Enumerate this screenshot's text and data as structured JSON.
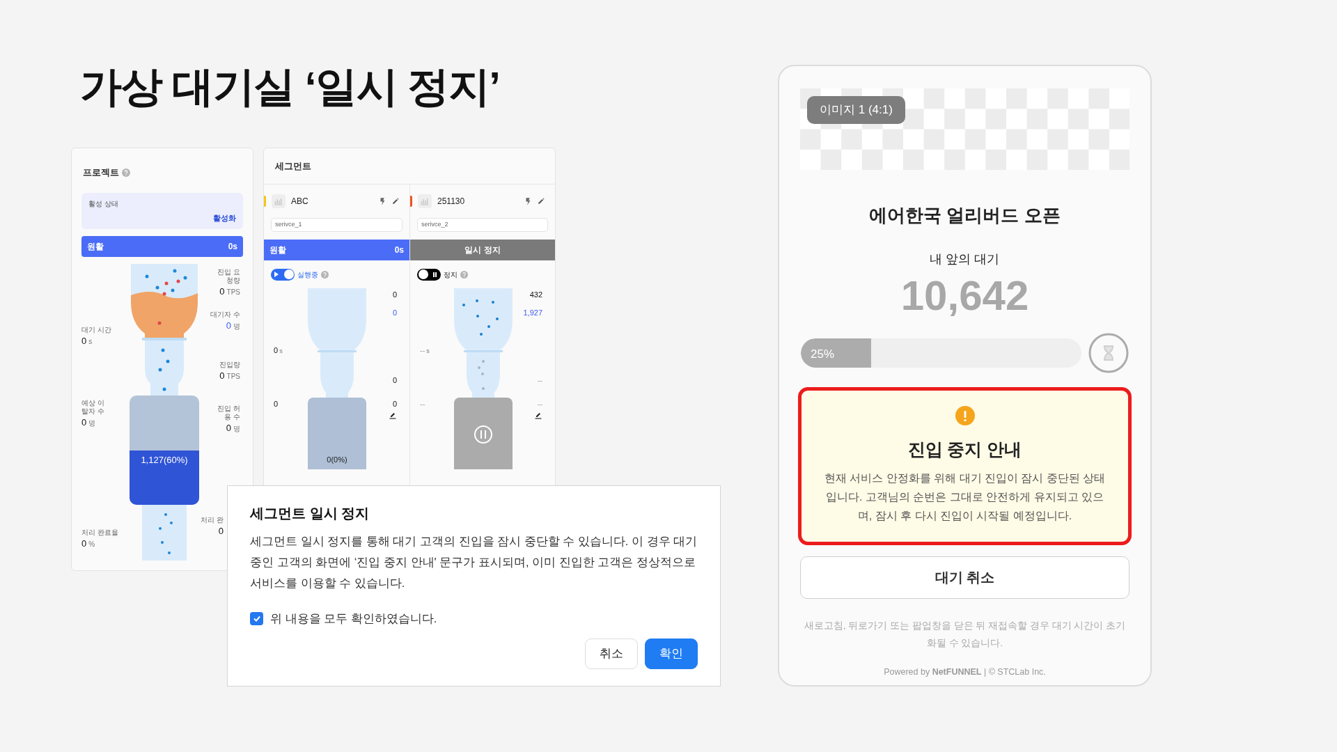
{
  "slide_title": "가상 대기실 ‘일시 정지’",
  "project": {
    "title": "프로젝트",
    "status_box": {
      "label": "활성 상태",
      "value": "활성화"
    },
    "status_bar": {
      "kind": "smooth",
      "label": "원활",
      "value": "0s"
    },
    "metrics": {
      "request_rate": {
        "label": "진입 요청량",
        "value": "0",
        "unit": "TPS",
        "accent": false
      },
      "waiting": {
        "label": "대기자 수",
        "value": "0",
        "unit": "명",
        "accent": true
      },
      "wait_time": {
        "label": "대기 시간",
        "value": "0",
        "unit": "s",
        "accent": false
      },
      "entry_rate": {
        "label": "진입량",
        "value": "0",
        "unit": "TPS",
        "accent": false
      },
      "dropouts": {
        "label": "예상 이탈자 수",
        "value": "0",
        "unit": "명",
        "accent": false
      },
      "allowed": {
        "label": "진입 허용 수",
        "value": "0",
        "unit": "명",
        "accent": false
      },
      "completion_rate": {
        "label": "처리 완료율",
        "value": "0",
        "unit": "%",
        "accent": false
      },
      "processed": {
        "label": "처리 완",
        "value": "0",
        "accent": false
      }
    },
    "fill_label": "1,127(60%)"
  },
  "segments_panel": {
    "title": "세그먼트",
    "segments": [
      {
        "name": "ABC",
        "color": "#f5c518",
        "service": "serivce_1",
        "status_bar": {
          "kind": "smooth",
          "label": "원활",
          "value": "0s"
        },
        "toggle": {
          "on": true,
          "label": "실행중"
        },
        "stats": {
          "request_rate": {
            "value": "0",
            "accent": false
          },
          "waiting": {
            "value": "0",
            "accent": true
          },
          "wait_time": {
            "value": "0",
            "unit": "s",
            "accent": false
          },
          "entry_rate": {
            "value": "0",
            "accent": false
          },
          "dropouts": {
            "value": "0",
            "accent": false
          },
          "allowed": {
            "value": "0",
            "accent": false
          }
        },
        "fill_label": "0(0%)"
      },
      {
        "name": "251130",
        "color": "#f0521e",
        "service": "serivce_2",
        "status_bar": {
          "kind": "paused",
          "label": "일시 정지"
        },
        "toggle": {
          "on": false,
          "label": "정지"
        },
        "stats": {
          "request_rate": {
            "value": "432",
            "accent": false
          },
          "waiting": {
            "value": "1,927",
            "accent": true
          },
          "wait_time": {
            "value": "--",
            "unit": "s",
            "accent": false
          },
          "entry_rate": {
            "value": "--",
            "accent": false
          },
          "dropouts": {
            "value": "--",
            "accent": false
          },
          "allowed": {
            "value": "--",
            "accent": false
          }
        }
      }
    ]
  },
  "dialog": {
    "title": "세그먼트 일시 정지",
    "body": "세그먼트 일시 정지를 통해 대기 고객의 진입을 잠시 중단할 수 있습니다. 이 경우 대기 중인 고객의 화면에 ‘진입 중지 안내' 문구가 표시되며, 이미 진입한 고객은 정상적으로 서비스를 이용할 수 있습니다.",
    "checkbox": {
      "label": "위 내용을 모두 확인하였습니다.",
      "checked": true
    },
    "buttons": [
      {
        "label": "취소",
        "kind": "secondary"
      },
      {
        "label": "확인",
        "kind": "primary"
      }
    ]
  },
  "waiting_page": {
    "image_badge": "이미지 1 (4:1)",
    "title": "에어한국 얼리버드 오픈",
    "queue_label": "내 앞의 대기",
    "queue_count": "10,642",
    "progress": {
      "level": 0.25,
      "label": "25%"
    },
    "notice": {
      "title": "진입 중지 안내",
      "body": "현재 서비스 안정화를 위해 대기 진입이 잠시 중단된 상태입니다. 고객님의 순번은 그대로 안전하게 유지되고 있으며, 잠시 후 다시 진입이 시작될 예정입니다.",
      "highlighted": true
    },
    "cancel_button": "대기 취소",
    "note": "새로고침, 뒤로가기 또는 팝업창을 닫은 뒤 재접속할 경우 대기 시간이 초기화될 수 있습니다.",
    "footer": "Powered by **NetFUNNEL** | © STCLab Inc."
  }
}
